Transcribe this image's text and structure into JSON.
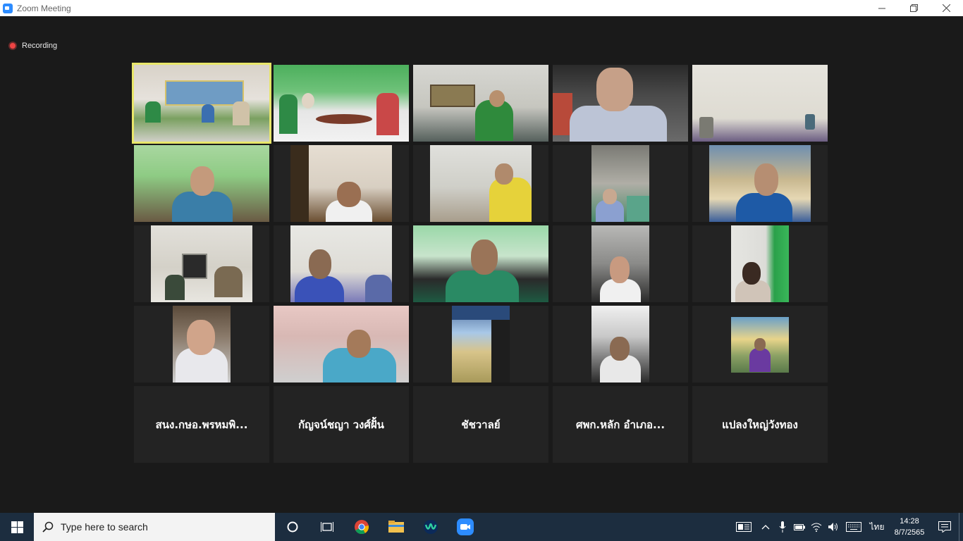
{
  "window": {
    "title": "Zoom Meeting",
    "minimize_icon": "minimize-icon",
    "restore_icon": "restore-icon",
    "close_icon": "close-icon"
  },
  "recording": {
    "label": "Recording",
    "color": "#ee4444"
  },
  "active_speaker_color": "#e8e66a",
  "participants_without_video": [
    "สนง.กษอ.พรหมพิ...",
    "กัญจน์ชญา วงศ์ฝั้น",
    "ชัชวาลย์",
    "ศพก.หลัก อำเภอ...",
    "แปลงใหญ่วังทอง"
  ],
  "taskbar": {
    "search_placeholder": "Type here to search",
    "apps": [
      "task-view",
      "chrome",
      "file-explorer",
      "webex",
      "zoom"
    ],
    "language": "ไทย",
    "time": "14:28",
    "date": "8/7/2565"
  }
}
